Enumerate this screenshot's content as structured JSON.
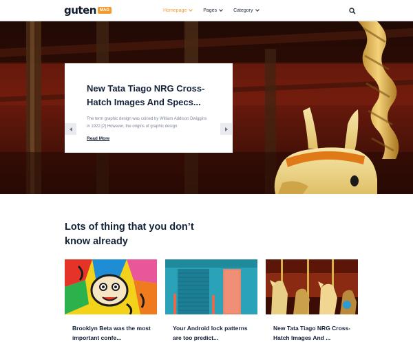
{
  "header": {
    "logo_text": "guten",
    "logo_badge": "MAG",
    "nav": [
      {
        "label": "Homepage",
        "active": true
      },
      {
        "label": "Pages",
        "active": false
      },
      {
        "label": "Category",
        "active": false
      }
    ],
    "search_icon": "search-icon"
  },
  "hero": {
    "slide": {
      "title": "New Tata Tiago NRG Cross-Hatch Images And Specs...",
      "excerpt": "The term graphic design was coined by William Addison Dwiggins in 1922.[2] However, the origins of graphic design",
      "read_more": "Read More"
    },
    "prev_icon": "chevron-left-icon",
    "next_icon": "chevron-right-icon"
  },
  "section": {
    "title": "Lots of thing that you don’t know already"
  },
  "cards": [
    {
      "title": "Brooklyn Beta was the most important confe..."
    },
    {
      "title": "Your Android lock patterns are too predict..."
    },
    {
      "title": "New Tata Tiago NRG Cross-Hatch Images And ..."
    }
  ],
  "colors": {
    "accent": "#f29a2e",
    "text_dark": "#15233a",
    "text_muted": "#7b8594"
  }
}
